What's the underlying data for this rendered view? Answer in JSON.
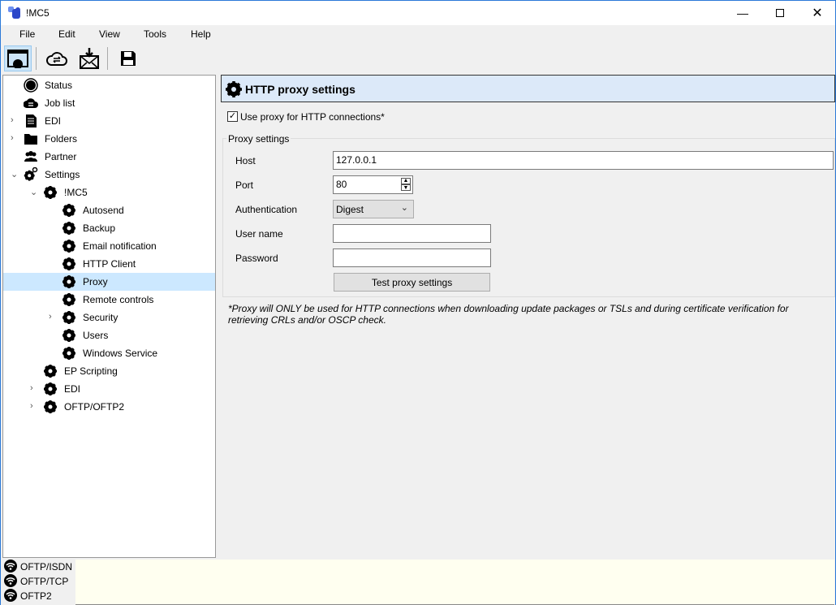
{
  "window": {
    "title": "!MC5",
    "controls": [
      "minimize",
      "maximize",
      "close"
    ]
  },
  "menu": [
    "File",
    "Edit",
    "View",
    "Tools",
    "Help"
  ],
  "toolbar": [
    {
      "icon": "dashboard-icon",
      "selected": true
    },
    {
      "icon": "cloud-sync-icon"
    },
    {
      "icon": "mail-download-icon"
    },
    {
      "icon": "save-icon"
    }
  ],
  "tree": [
    {
      "label": "Status",
      "level": 0,
      "icon": "status-icon",
      "expander": ""
    },
    {
      "label": "Job list",
      "level": 0,
      "icon": "cloud-sync-icon",
      "expander": ""
    },
    {
      "label": "EDI",
      "level": 0,
      "icon": "document-icon",
      "expander": ">"
    },
    {
      "label": "Folders",
      "level": 0,
      "icon": "folder-icon",
      "expander": ">"
    },
    {
      "label": "Partner",
      "level": 0,
      "icon": "people-icon",
      "expander": ""
    },
    {
      "label": "Settings",
      "level": 0,
      "icon": "gears-icon",
      "expander": "v"
    },
    {
      "label": "!MC5",
      "level": 1,
      "icon": "gear-icon",
      "expander": "v"
    },
    {
      "label": "Autosend",
      "level": 2,
      "icon": "gear-icon",
      "expander": ""
    },
    {
      "label": "Backup",
      "level": 2,
      "icon": "gear-icon",
      "expander": ""
    },
    {
      "label": "Email notification",
      "level": 2,
      "icon": "gear-icon",
      "expander": ""
    },
    {
      "label": "HTTP Client",
      "level": 2,
      "icon": "gear-icon",
      "expander": ""
    },
    {
      "label": "Proxy",
      "level": 2,
      "icon": "gear-icon",
      "expander": "",
      "selected": true
    },
    {
      "label": "Remote controls",
      "level": 2,
      "icon": "gear-icon",
      "expander": ""
    },
    {
      "label": "Security",
      "level": 2,
      "icon": "gear-icon",
      "expander": ">"
    },
    {
      "label": "Users",
      "level": 2,
      "icon": "gear-icon",
      "expander": ""
    },
    {
      "label": "Windows Service",
      "level": 2,
      "icon": "gear-icon",
      "expander": ""
    },
    {
      "label": "EP Scripting",
      "level": 1,
      "icon": "gear-icon",
      "expander": ""
    },
    {
      "label": "EDI",
      "level": 1,
      "icon": "gear-icon",
      "expander": ">"
    },
    {
      "label": "OFTP/OFTP2",
      "level": 1,
      "icon": "gear-icon",
      "expander": ">"
    }
  ],
  "panel": {
    "title": "HTTP proxy settings",
    "use_proxy_label": "Use proxy for HTTP connections*",
    "use_proxy_checked": true,
    "group_label": "Proxy settings",
    "host_label": "Host",
    "host_value": "127.0.0.1",
    "port_label": "Port",
    "port_value": "80",
    "auth_label": "Authentication",
    "auth_value": "Digest",
    "user_label": "User name",
    "user_value": "",
    "password_label": "Password",
    "password_value": "",
    "test_button": "Test proxy settings",
    "note": "*Proxy will ONLY be used for HTTP connections when downloading update packages or TSLs and during certificate verification for retrieving CRLs and/or OSCP check."
  },
  "status": {
    "connections": [
      "OFTP/ISDN",
      "OFTP/TCP",
      "OFTP2"
    ]
  }
}
